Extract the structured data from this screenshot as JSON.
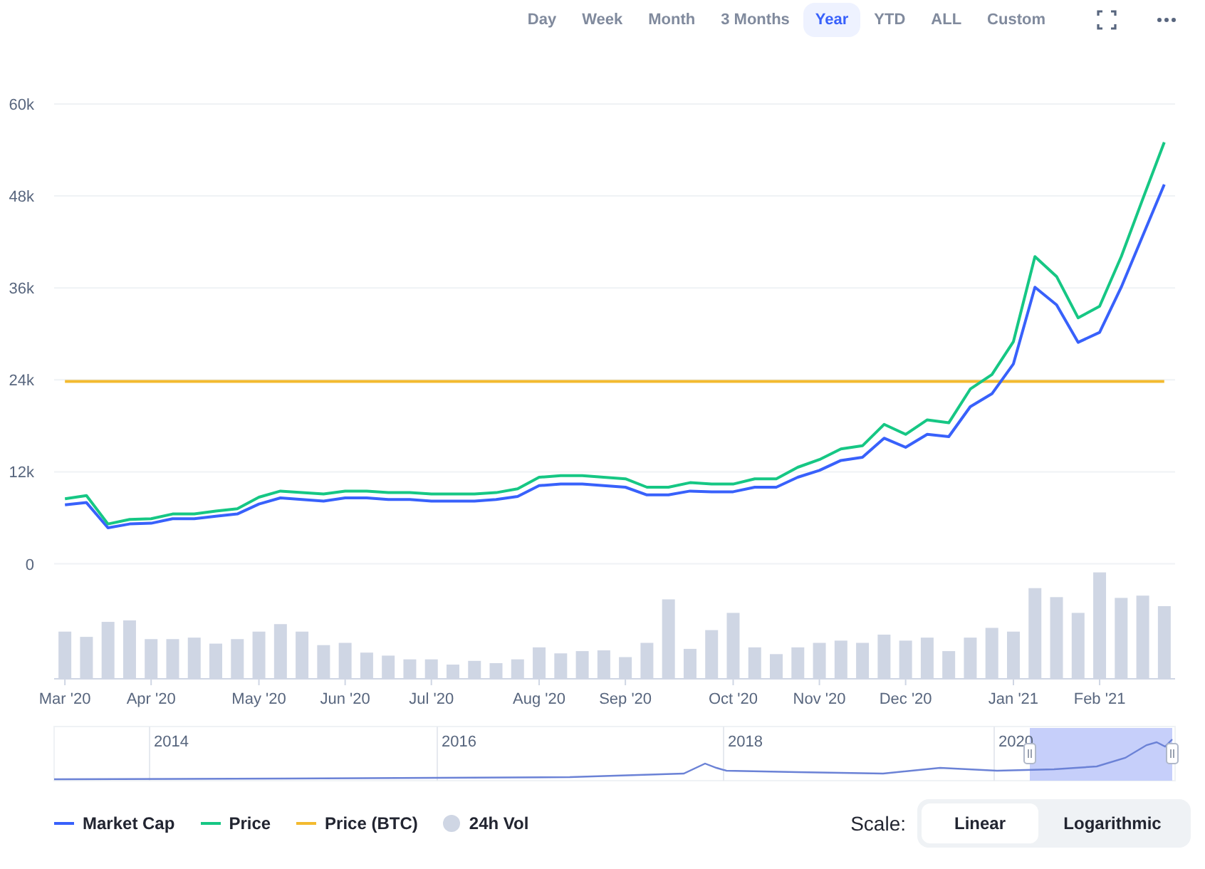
{
  "toolbar": {
    "ranges": [
      {
        "label": "Day",
        "selected": false
      },
      {
        "label": "Week",
        "selected": false
      },
      {
        "label": "Month",
        "selected": false
      },
      {
        "label": "3 Months",
        "selected": false
      },
      {
        "label": "Year",
        "selected": true
      },
      {
        "label": "YTD",
        "selected": false
      },
      {
        "label": "ALL",
        "selected": false
      },
      {
        "label": "Custom",
        "selected": false
      }
    ]
  },
  "chart": {
    "chart_data": {
      "type": "line",
      "categories": [
        "Mar '20",
        null,
        null,
        null,
        "Apr '20",
        null,
        null,
        null,
        null,
        "May '20",
        null,
        null,
        null,
        "Jun '20",
        null,
        null,
        null,
        "Jul '20",
        null,
        null,
        null,
        null,
        "Aug '20",
        null,
        null,
        null,
        "Sep '20",
        null,
        null,
        null,
        null,
        "Oct '20",
        null,
        null,
        null,
        "Nov '20",
        null,
        null,
        null,
        "Dec '20",
        null,
        null,
        null,
        null,
        "Jan '21",
        null,
        null,
        null,
        "Feb '21",
        null,
        null,
        null
      ],
      "ylim": [
        -15000,
        60000
      ],
      "grid": true,
      "yticks": [
        {
          "value": 0,
          "label": "0"
        },
        {
          "value": 12000,
          "label": "12k"
        },
        {
          "value": 24000,
          "label": "24k"
        },
        {
          "value": 36000,
          "label": "36k"
        },
        {
          "value": 48000,
          "label": "48k"
        },
        {
          "value": 60000,
          "label": "60k"
        }
      ],
      "series": [
        {
          "name": "Market Cap",
          "color": "#3861fb",
          "values": [
            7700,
            8000,
            4700,
            5200,
            5300,
            5900,
            5900,
            6200,
            6500,
            7800,
            8600,
            8400,
            8200,
            8600,
            8600,
            8400,
            8400,
            8200,
            8200,
            8200,
            8400,
            8800,
            10200,
            10400,
            10400,
            10200,
            10000,
            9000,
            9000,
            9500,
            9400,
            9400,
            10000,
            10000,
            11300,
            12200,
            13500,
            13900,
            16400,
            15200,
            16900,
            16600,
            20500,
            22200,
            26100,
            36100,
            33800,
            28900,
            30200,
            36100,
            42800,
            49500
          ]
        },
        {
          "name": "Price",
          "color": "#16c784",
          "values": [
            8500,
            8900,
            5200,
            5800,
            5900,
            6500,
            6500,
            6900,
            7200,
            8700,
            9500,
            9300,
            9100,
            9500,
            9500,
            9300,
            9300,
            9100,
            9100,
            9100,
            9300,
            9800,
            11300,
            11500,
            11500,
            11300,
            11100,
            10000,
            10000,
            10600,
            10400,
            10400,
            11100,
            11100,
            12600,
            13600,
            15000,
            15400,
            18200,
            16900,
            18800,
            18400,
            22800,
            24700,
            29000,
            40100,
            37500,
            32100,
            33600,
            40100,
            47600,
            55000
          ]
        },
        {
          "name": "Price (BTC)",
          "color": "#f3ba2f",
          "values": [
            23800,
            23800,
            23800,
            23800,
            23800,
            23800,
            23800,
            23800,
            23800,
            23800,
            23800,
            23800,
            23800,
            23800,
            23800,
            23800,
            23800,
            23800,
            23800,
            23800,
            23800,
            23800,
            23800,
            23800,
            23800,
            23800,
            23800,
            23800,
            23800,
            23800,
            23800,
            23800,
            23800,
            23800,
            23800,
            23800,
            23800,
            23800,
            23800,
            23800,
            23800,
            23800,
            23800,
            23800,
            23800,
            23800,
            23800,
            23800,
            23800,
            23800,
            23800,
            23800
          ]
        }
      ]
    }
  },
  "navigator": {
    "labels": [
      "2014",
      "2016",
      "2018",
      "2020"
    ]
  },
  "volume_legend": {
    "name": "24h Vol",
    "color": "#cfd6e4"
  },
  "scale": {
    "label": "Scale:",
    "options": [
      {
        "label": "Linear",
        "selected": true
      },
      {
        "label": "Logarithmic",
        "selected": false
      }
    ]
  }
}
